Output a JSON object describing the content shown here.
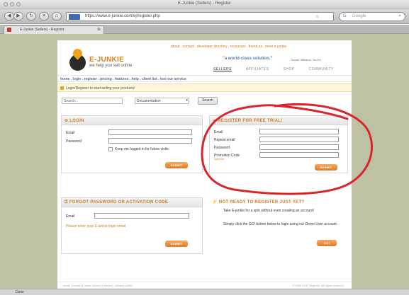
{
  "window": {
    "title": "E-Junkie (Sellers) - Register"
  },
  "toolbar": {
    "url": "https://www.e-junkie.com/ej/register.php",
    "rss_glyph": "☆",
    "search_placeholder": "Google"
  },
  "tab": {
    "label": "E-Junkie (Sellers) - Register"
  },
  "brand": {
    "name": "E-JUNKIE",
    "tagline": "we help you sell online"
  },
  "top_links": "about . contact . developer directory . resources . friend us . meet e-junkie",
  "quote": {
    "text": "\"a world-class solution.\"",
    "author": "- Tanner Williams, YouTel"
  },
  "site_tabs": [
    "SELLERS",
    "AFFILIATES",
    "SHOP",
    "COMMUNITY"
  ],
  "nav": "home . login . register . pricing . features . help . client list . test our service",
  "notice": "Login/Register to start selling your products!",
  "search": {
    "placeholder": "Search...",
    "select_value": "Documentation",
    "button": "Search"
  },
  "login": {
    "title": "LOGIN",
    "email_label": "Email",
    "password_label": "Password",
    "remember_label": "Keep me logged in for future visits",
    "submit": "SUBMIT"
  },
  "register": {
    "title": "REGISTER FOR FREE TRIAL!",
    "email_label": "Email",
    "repeat_email_label": "Repeat email",
    "password_label": "Password",
    "promo_label": "Promotion Code",
    "promo_note": "optional",
    "submit": "SUBMIT"
  },
  "forgot": {
    "title": "FORGOT PASSWORD OR ACTIVATION CODE",
    "email_label": "Email",
    "note": "Please enter your E-junkie login email",
    "submit": "SUBMIT"
  },
  "not_ready": {
    "title": "NOT READY TO REGISTER JUST YET?",
    "line1": "Take E-junkie for a spin without even creating an account!",
    "line2": "Simply click the GO! button below to login using our Demo User account.",
    "button": "GO!"
  },
  "footer": {
    "links": "about | contact | resell | terms of service | privacy policy",
    "copyright": "© 2009 10 E Degrees. All rights reserved."
  },
  "status": {
    "text": "Done"
  },
  "colors": {
    "accent": "#d8821a",
    "annotation": "#d9262b"
  }
}
